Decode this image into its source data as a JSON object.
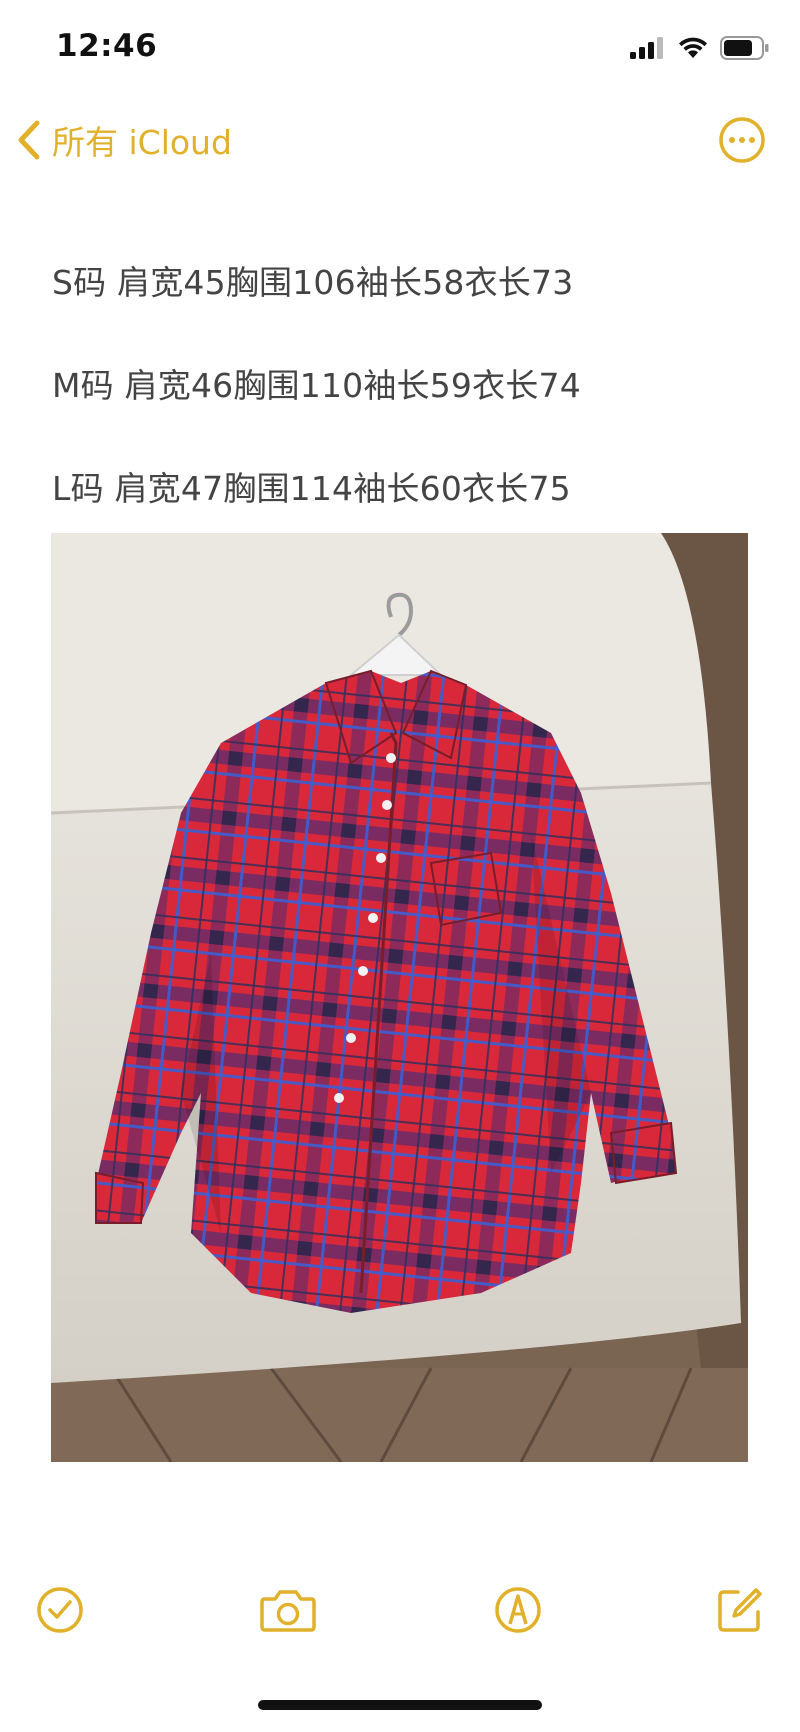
{
  "status_bar": {
    "time": "12:46",
    "icons": [
      "cellular-signal-icon",
      "wifi-icon",
      "battery-icon"
    ]
  },
  "nav": {
    "back_label": "所有 iCloud",
    "back_icon": "chevron-left-icon",
    "more_icon": "ellipsis-circle-icon"
  },
  "note": {
    "lines": [
      "S码 肩宽45胸围106袖长58衣长73",
      "M码 肩宽46胸围110袖长59衣长74",
      "L码 肩宽47胸围114袖长60衣长75"
    ],
    "photo": "red-blue-plaid-shirt-on-hanger-photo"
  },
  "toolbar": {
    "checklist_icon": "checklist-icon",
    "camera_icon": "camera-icon",
    "markup_icon": "markup-pen-icon",
    "compose_icon": "compose-icon"
  },
  "colors": {
    "accent": "#e1b12c",
    "text": "#444444",
    "background": "#ffffff"
  }
}
